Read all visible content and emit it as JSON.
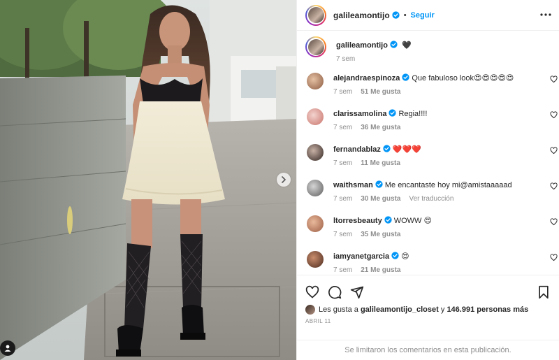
{
  "post": {
    "username": "galileamontijo",
    "follow_label": "Seguir",
    "separator": "•",
    "caption_text": "🖤",
    "caption_time": "7 sem",
    "comments": [
      {
        "username": "alejandraespinoza",
        "text": "Que fabuloso look😍😍😍😍😍",
        "time": "7 sem",
        "likes": "51 Me gusta",
        "reply": "",
        "avatar_color": "#b78a6a"
      },
      {
        "username": "clarissamolina",
        "text": "Regia!!!!",
        "time": "7 sem",
        "likes": "36 Me gusta",
        "reply": "",
        "avatar_color": "#d9a3a0"
      },
      {
        "username": "fernandablaz",
        "text": "❤️❤️❤️",
        "time": "7 sem",
        "likes": "11 Me gusta",
        "reply": "",
        "avatar_color": "#4a3a33"
      },
      {
        "username": "waithsman",
        "text": "Me encantaste hoy mi@amistaaaaad",
        "time": "7 sem",
        "likes": "30 Me gusta",
        "reply": "Ver traducción",
        "avatar_color": "#8b8b8b"
      },
      {
        "username": "ltorresbeauty",
        "text": "WOWW 😍",
        "time": "7 sem",
        "likes": "35 Me gusta",
        "reply": "",
        "avatar_color": "#c98a6b"
      },
      {
        "username": "iamyanetgarcia",
        "text": "😍",
        "time": "7 sem",
        "likes": "21 Me gusta",
        "reply": "",
        "avatar_color": "#7a4a36"
      }
    ],
    "likes_prefix": "Les gusta a",
    "likes_user": "galileamontijo_closet",
    "likes_and": "y",
    "likes_count": "146.991 personas más",
    "date": "Abril 11",
    "comments_limited": "Se limitaron los comentarios en esta publicación."
  },
  "icons": {
    "verified": "verified-badge-icon",
    "more": "more-options-icon",
    "like": "heart-icon",
    "comment": "comment-icon",
    "share": "share-icon",
    "save": "bookmark-icon",
    "next": "chevron-right-icon",
    "user_tag": "user-tag-icon"
  },
  "colors": {
    "accent": "#0095f6",
    "text": "#262626",
    "muted": "#8e8e8e",
    "border": "#efefef"
  }
}
